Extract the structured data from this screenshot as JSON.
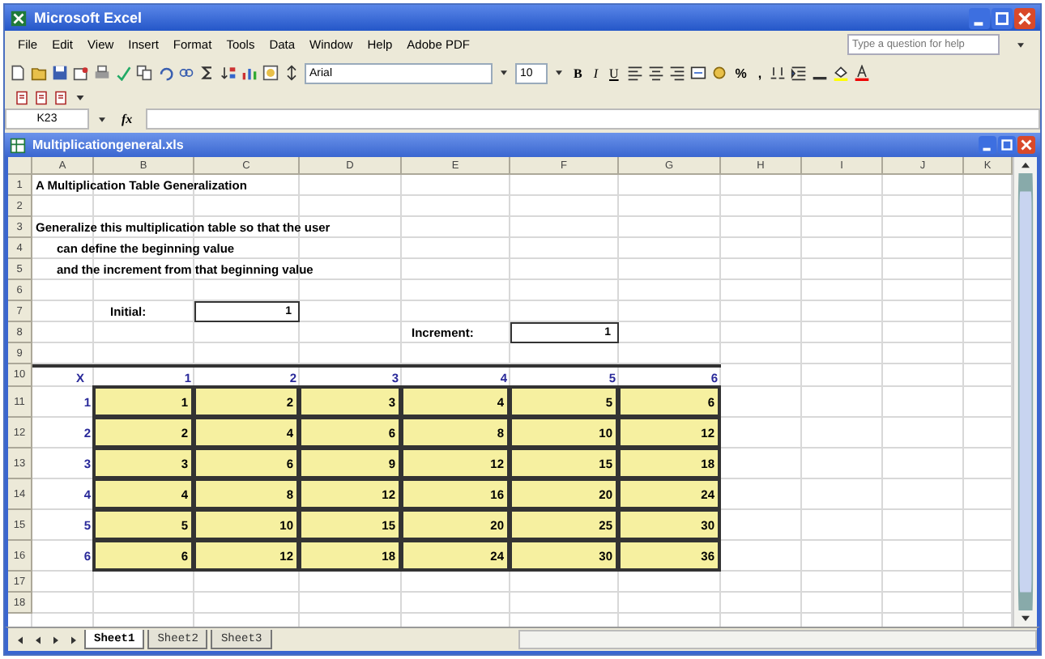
{
  "app": {
    "title": "Microsoft Excel"
  },
  "menu": [
    "File",
    "Edit",
    "View",
    "Insert",
    "Format",
    "Tools",
    "Data",
    "Window",
    "Help",
    "Adobe PDF"
  ],
  "help_box": {
    "placeholder": "Type a question for help"
  },
  "font_box": {
    "value": "Arial"
  },
  "size_box": {
    "value": "10"
  },
  "format_buttons": [
    "B",
    "I",
    "U"
  ],
  "number_buttons": [
    "%",
    ","
  ],
  "formula_bar": {
    "name_box": "K23",
    "fx": "fx"
  },
  "workbook": {
    "title": "Multiplicationgeneral.xls"
  },
  "sheet": {
    "columns": [
      "A",
      "B",
      "C",
      "D",
      "E",
      "F",
      "G",
      "H",
      "I",
      "J",
      "K"
    ],
    "row_numbers": [
      "1",
      "2",
      "3",
      "4",
      "5",
      "6",
      "7",
      "8",
      "9",
      "10",
      "11",
      "12",
      "13",
      "14",
      "15",
      "16",
      "17",
      "18"
    ],
    "title": "A Multiplication Table Generalization",
    "instructions": [
      "Generalize this multiplication table so that the user",
      "can define the beginning value",
      "and the increment from that beginning value"
    ],
    "inputs": [
      {
        "label": "Initial:",
        "value": "1"
      },
      {
        "label": "Increment:",
        "value": "1"
      }
    ],
    "table": {
      "corner": "X",
      "col_headers": [
        "1",
        "2",
        "3",
        "4",
        "5",
        "6"
      ],
      "rows": [
        {
          "header": "1",
          "values": [
            "1",
            "2",
            "3",
            "4",
            "5",
            "6"
          ]
        },
        {
          "header": "2",
          "values": [
            "2",
            "4",
            "6",
            "8",
            "10",
            "12"
          ]
        },
        {
          "header": "3",
          "values": [
            "3",
            "6",
            "9",
            "12",
            "15",
            "18"
          ]
        },
        {
          "header": "4",
          "values": [
            "4",
            "8",
            "12",
            "16",
            "20",
            "24"
          ]
        },
        {
          "header": "5",
          "values": [
            "5",
            "10",
            "15",
            "20",
            "25",
            "30"
          ]
        },
        {
          "header": "6",
          "values": [
            "6",
            "12",
            "18",
            "24",
            "30",
            "36"
          ]
        }
      ]
    }
  },
  "sheet_tabs": [
    {
      "label": "Sheet1",
      "selected": true
    },
    {
      "label": "Sheet2",
      "selected": false
    },
    {
      "label": "Sheet3",
      "selected": false
    }
  ]
}
